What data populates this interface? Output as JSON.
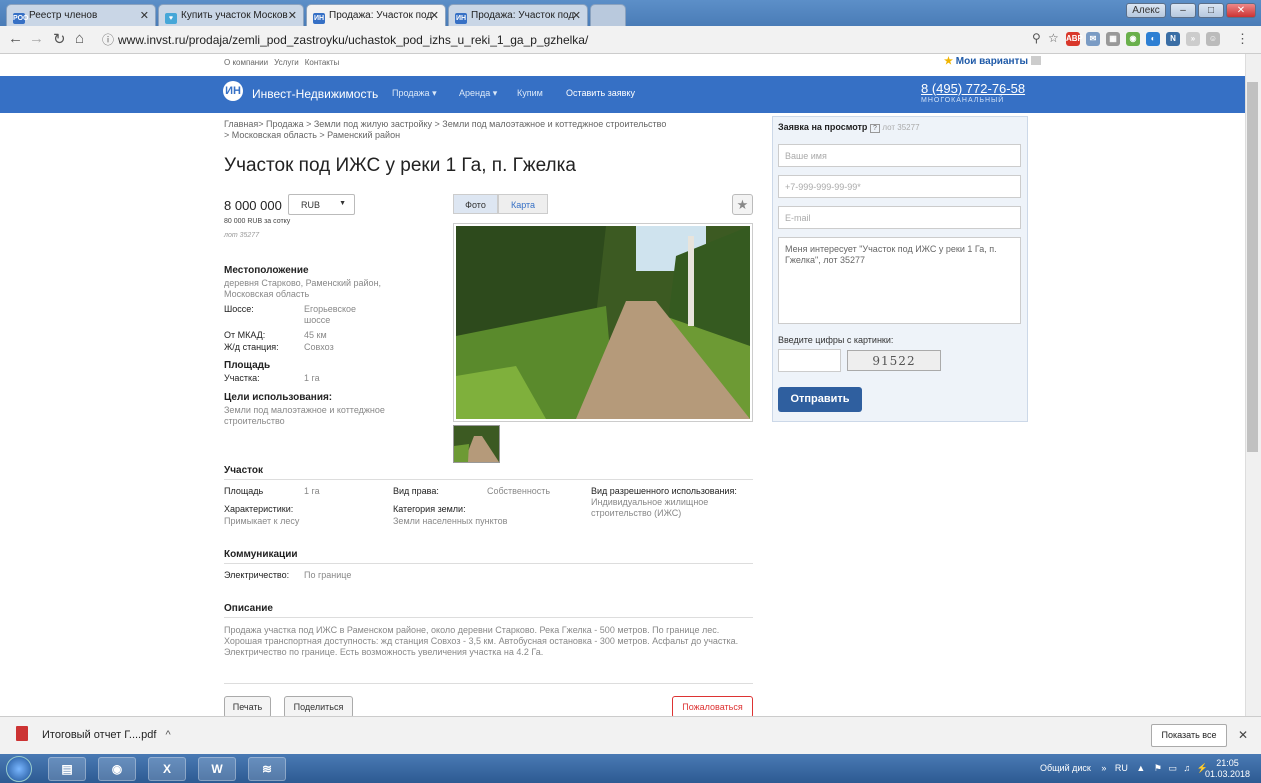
{
  "browser": {
    "tabs": [
      {
        "label": "Реестр членов",
        "fav": "РОО",
        "fav_color": "#3670c5"
      },
      {
        "label": "Купить участок Москов",
        "fav": "♥",
        "fav_color": "#46a7d8"
      },
      {
        "label": "Продажа: Участок под ",
        "fav": "ИН",
        "fav_color": "#3670c5"
      },
      {
        "label": "Продажа: Участок под ",
        "fav": "ИН",
        "fav_color": "#3670c5"
      }
    ],
    "window_user": "Алекс",
    "url": "www.invst.ru/prodaja/zemli_pod_zastroyku/uchastok_pod_izhs_u_reki_1_ga_p_gzhelka/"
  },
  "site": {
    "top_links": [
      "О компании",
      "Услуги",
      "Контакты"
    ],
    "my_variants": "Мои варианты",
    "brand": "Инвест-Недвижимость",
    "logo": "ИН",
    "nav": [
      "Продажа",
      "Аренда",
      "Купим",
      "Оставить заявку"
    ],
    "phone": "8 (495) 772-76-58",
    "phone_sub": "МНОГОКАНАЛЬНЫЙ"
  },
  "listing": {
    "breadcrumbs_line1": "Главная> Продажа > Земли под жилую застройку > Земли под малоэтажное и коттеджное строительство",
    "breadcrumbs_line2": "> Московская область > Раменский район",
    "title": "Участок под ИЖС у реки 1 Га, п. Гжелка",
    "price": "8 000 000",
    "currency": "RUB",
    "price_per": "80 000 RUB  за сотку",
    "lot": "лот 35277",
    "location_hdr": "Местоположение",
    "location_text": "деревня Старково, Раменский район, Московская область",
    "highway_lbl": "Шоссе:",
    "highway_val": "Егорьевское шоссе",
    "mkad_lbl": "От МКАД:",
    "mkad_val": "45 км",
    "station_lbl": "Ж/д станция:",
    "station_val": "Совхоз",
    "area_hdr": "Площадь",
    "plot_lbl": "Участка:",
    "plot_val": "1 га",
    "purpose_hdr": "Цели использования:",
    "purpose_val": "Земли под малоэтажное и коттеджное строительство",
    "photo_tab": "Фото",
    "map_tab": "Карта"
  },
  "plot_section": {
    "hdr": "Участок",
    "area_lbl": "Площадь",
    "area_val": "1 га",
    "right_lbl": "Вид права:",
    "right_val": "Собственность",
    "use_lbl": "Вид разрешенного использования:",
    "use_val": "Индивидуальное жилищное строительство (ИЖС)",
    "char_lbl": "Характеристики:",
    "char_val": "Примыкает к лесу",
    "cat_lbl": "Категория земли:",
    "cat_val": "Земли населенных пунктов"
  },
  "comm": {
    "hdr": "Коммуникации",
    "elec_lbl": "Электричество:",
    "elec_val": "По границе"
  },
  "desc": {
    "hdr": "Описание",
    "text": "Продажа участка под ИЖС в Раменском районе, около деревни Старково. Река Гжелка - 500 метров. По границе лес. Хорошая транспортная доступность: жд станция Совхоз - 3,5 км. Автобусная остановка - 300 метров. Асфальт до участка. Электричество по границе. Есть возможность увеличения участка на 4.2 Га."
  },
  "buttons": {
    "print": "Печать",
    "share": "Поделиться",
    "complain": "Пожаловаться"
  },
  "form": {
    "title": "Заявка на просмотр",
    "help": "?",
    "lot": "лот 35277",
    "name_ph": "Ваше имя",
    "phone_ph": "+7-999-999-99-99*",
    "email_ph": "E-mail",
    "message": "Меня интересует \"Участок под ИЖС у реки 1 Га, п. Гжелка\", лот 35277",
    "captcha_lbl": "Введите цифры с картинки:",
    "captcha_img": "91522",
    "submit": "Отправить"
  },
  "downloads": {
    "file": "Итоговый отчет Г....pdf",
    "show_all": "Показать все"
  },
  "taskbar": {
    "disk": "Общий диск",
    "lang": "RU",
    "time": "21:05",
    "date": "01.03.2018"
  }
}
